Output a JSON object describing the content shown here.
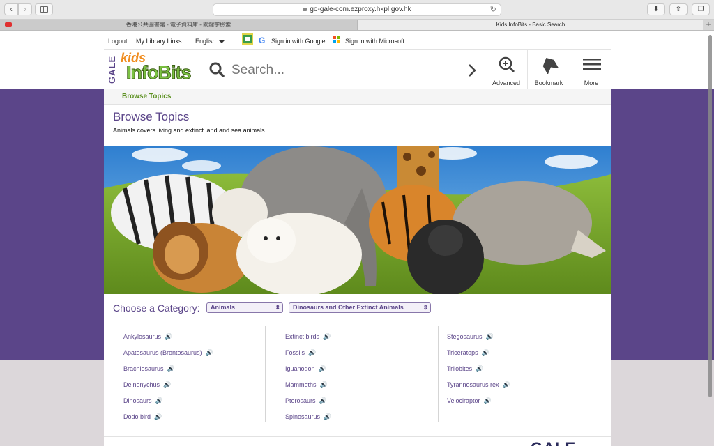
{
  "browser": {
    "url": "go-gale-com.ezproxy.hkpl.gov.hk",
    "tabs": [
      {
        "label": "香港公共圖書館 - 電子資料庫 - 關鍵字檢索"
      },
      {
        "label": "Kids InfoBits - Basic Search"
      }
    ]
  },
  "utility": {
    "logout": "Logout",
    "library_links": "My Library Links",
    "language": "English",
    "google": "Sign in with Google",
    "microsoft": "Sign in with Microsoft"
  },
  "header": {
    "gale": "GALE",
    "kids": "kids",
    "infobits": "InfoBits",
    "search_placeholder": "Search...",
    "buttons": {
      "advanced": "Advanced",
      "bookmark": "Bookmark",
      "more": "More"
    }
  },
  "breadcrumb": "Browse Topics",
  "page": {
    "title": "Browse Topics",
    "description": "Animals covers living and extinct land and sea animals."
  },
  "category": {
    "label": "Choose a Category:",
    "primary": "Animals",
    "secondary": "Dinosaurs and Other Extinct Animals"
  },
  "topics": {
    "col1": [
      "Ankylosaurus",
      "Apatosaurus (Brontosaurus)",
      "Brachiosaurus",
      "Deinonychus",
      "Dinosaurs",
      "Dodo bird"
    ],
    "col2": [
      "Extinct birds",
      "Fossils",
      "Iguanodon",
      "Mammoths",
      "Pterosaurs",
      "Spinosaurus"
    ],
    "col3": [
      "Stegosaurus",
      "Triceratops",
      "Trilobites",
      "Tyrannosaurus rex",
      "Velociraptor"
    ]
  },
  "footer_logo": "GALE",
  "colors": {
    "brand_purple": "#5b4589",
    "brand_green": "#7cc243",
    "accent_orange": "#f08c1e"
  }
}
